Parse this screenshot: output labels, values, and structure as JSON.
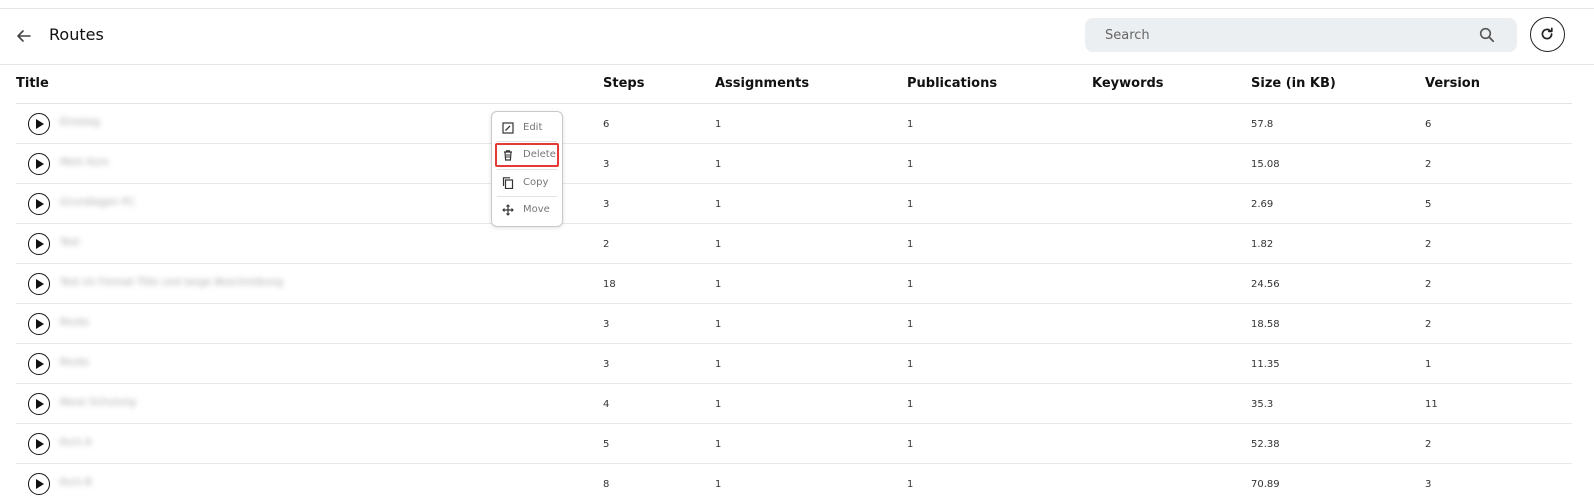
{
  "header": {
    "back_icon": "arrow-left-icon",
    "title": "Routes",
    "search_placeholder": "Search",
    "search_icon": "search-icon",
    "refresh_icon": "refresh-icon"
  },
  "table": {
    "columns": [
      "Title",
      "Steps",
      "Assignments",
      "Publications",
      "Keywords",
      "Size (in KB)",
      "Version"
    ],
    "rows": [
      {
        "title": "Einstieg",
        "steps": "6",
        "assignments": "1",
        "publications": "1",
        "keywords": "",
        "size": "57.8",
        "version": "6"
      },
      {
        "title": "Mein Kurs",
        "steps": "3",
        "assignments": "1",
        "publications": "1",
        "keywords": "",
        "size": "15.08",
        "version": "2"
      },
      {
        "title": "Grundlagen PC",
        "steps": "3",
        "assignments": "1",
        "publications": "1",
        "keywords": "",
        "size": "2.69",
        "version": "5"
      },
      {
        "title": "Test",
        "steps": "2",
        "assignments": "1",
        "publications": "1",
        "keywords": "",
        "size": "1.82",
        "version": "2"
      },
      {
        "title": "Test im Format Title und lange Beschreibung",
        "steps": "18",
        "assignments": "1",
        "publications": "1",
        "keywords": "",
        "size": "24.56",
        "version": "2"
      },
      {
        "title": "Route",
        "steps": "3",
        "assignments": "1",
        "publications": "1",
        "keywords": "",
        "size": "18.58",
        "version": "2"
      },
      {
        "title": "Route",
        "steps": "3",
        "assignments": "1",
        "publications": "1",
        "keywords": "",
        "size": "11.35",
        "version": "1"
      },
      {
        "title": "Neue Schulung",
        "steps": "4",
        "assignments": "1",
        "publications": "1",
        "keywords": "",
        "size": "35.3",
        "version": "11"
      },
      {
        "title": "Kurs A",
        "steps": "5",
        "assignments": "1",
        "publications": "1",
        "keywords": "",
        "size": "52.38",
        "version": "2"
      },
      {
        "title": "Kurs B",
        "steps": "8",
        "assignments": "1",
        "publications": "1",
        "keywords": "",
        "size": "70.89",
        "version": "3"
      }
    ]
  },
  "context_menu": {
    "items": [
      {
        "label": "Edit",
        "icon": "edit-icon"
      },
      {
        "label": "Delete",
        "icon": "trash-icon"
      },
      {
        "label": "Copy",
        "icon": "copy-icon"
      },
      {
        "label": "Move",
        "icon": "move-icon"
      }
    ],
    "highlighted": "Delete",
    "highlight_color": "#e53935"
  }
}
